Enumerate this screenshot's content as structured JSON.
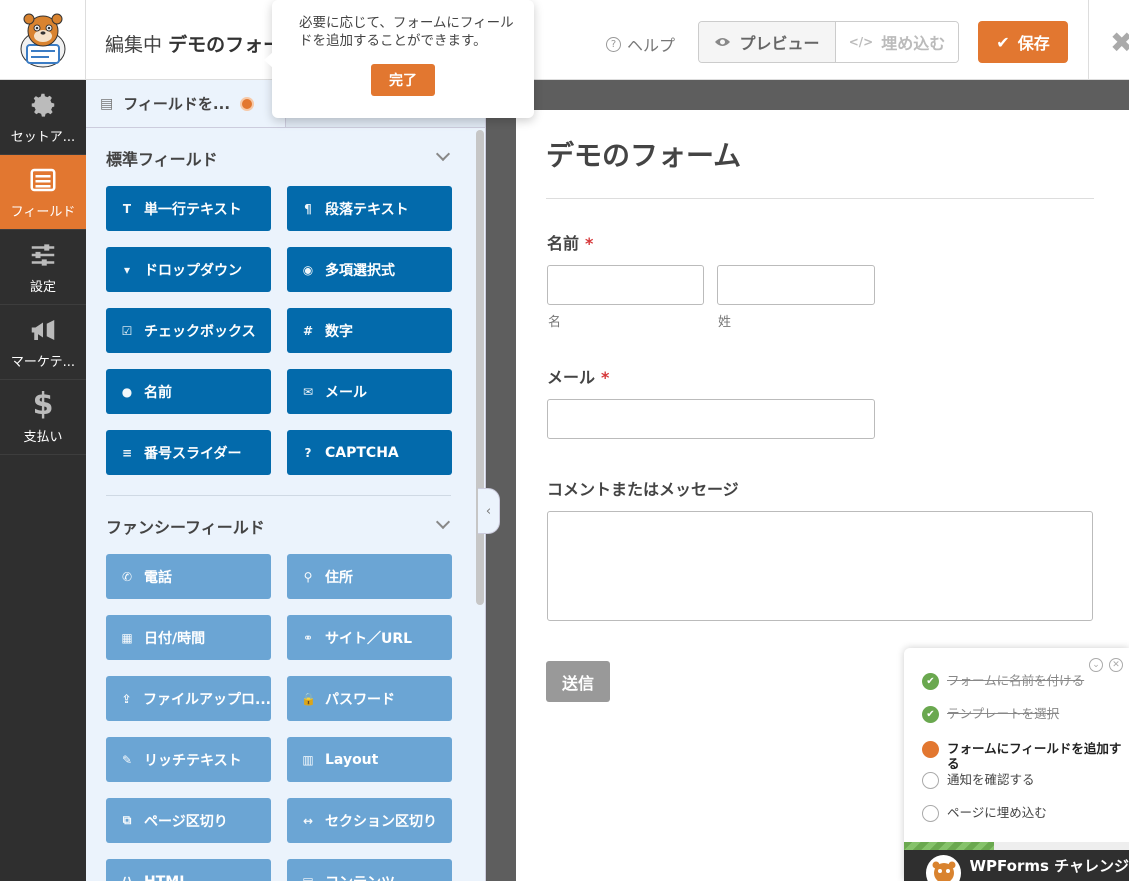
{
  "header": {
    "editing_prefix": "編集中",
    "form_name": "デモのフォーム",
    "help_label": "ヘルプ",
    "preview_label": "プレビュー",
    "embed_label": "埋め込む",
    "save_label": "保存"
  },
  "leftnav": {
    "items": [
      {
        "label": "セットア..."
      },
      {
        "label": "フィールド"
      },
      {
        "label": "設定"
      },
      {
        "label": "マーケテ..."
      },
      {
        "label": "支払い"
      }
    ]
  },
  "panel": {
    "tab_label": "フィールドを...",
    "standard_title": "標準フィールド",
    "standard": [
      "単一行テキスト",
      "段落テキスト",
      "ドロップダウン",
      "多項選択式",
      "チェックボックス",
      "数字",
      "名前",
      "メール",
      "番号スライダー",
      "CAPTCHA"
    ],
    "fancy_title": "ファンシーフィールド",
    "fancy": [
      "電話",
      "住所",
      "日付/時間",
      "サイト／URL",
      "ファイルアップロ...",
      "パスワード",
      "リッチテキスト",
      "Layout",
      "ページ区切り",
      "セクション区切り",
      "HTML",
      "コンテンツ"
    ]
  },
  "tooltip": {
    "text": "必要に応じて、フォームにフィールドを追加することができます。",
    "done_label": "完了"
  },
  "form": {
    "title": "デモのフォーム",
    "name_label": "名前",
    "first_sub": "名",
    "last_sub": "姓",
    "email_label": "メール",
    "comment_label": "コメントまたはメッセージ",
    "required_mark": "*",
    "submit_label": "送信"
  },
  "checklist": {
    "items": [
      {
        "label": "フォームに名前を付ける",
        "state": "done"
      },
      {
        "label": "テンプレートを選択",
        "state": "done"
      },
      {
        "label": "フォームにフィールドを追加する",
        "state": "current"
      },
      {
        "label": "通知を確認する",
        "state": "todo"
      },
      {
        "label": "ページに埋め込む",
        "state": "todo"
      }
    ],
    "progress": 0.4,
    "footer": "WPForms チャレンジ"
  },
  "colors": {
    "accent": "#e27730",
    "standard_button": "#036aab",
    "fancy_button": "#6ba5d4",
    "nav_bg": "#2f2f2f",
    "panel_bg": "#ebf3fc"
  }
}
